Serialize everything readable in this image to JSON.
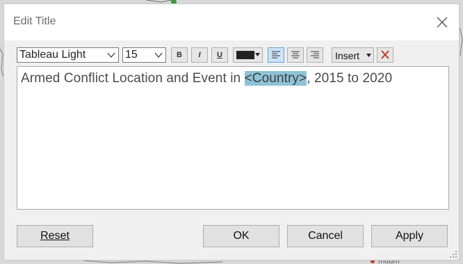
{
  "dialog": {
    "title": "Edit Title",
    "close_icon": "close-icon"
  },
  "toolbar": {
    "font_family": "Tableau Light",
    "font_size": "15",
    "bold_label": "B",
    "italic_label": "I",
    "underline_label": "U",
    "text_color": "#222222",
    "alignment_selected": "left",
    "insert_label": "Insert",
    "clear_icon": "red-x-icon"
  },
  "editor": {
    "text_before": "Armed Conflict Location and Event in ",
    "field_token": "<Country>",
    "text_after": ", 2015 to 2020",
    "highlight_color": "#8ec2d8"
  },
  "buttons": {
    "reset": "Reset",
    "ok": "OK",
    "cancel": "Cancel",
    "apply": "Apply"
  },
  "background": {
    "partial_label": "muum"
  }
}
